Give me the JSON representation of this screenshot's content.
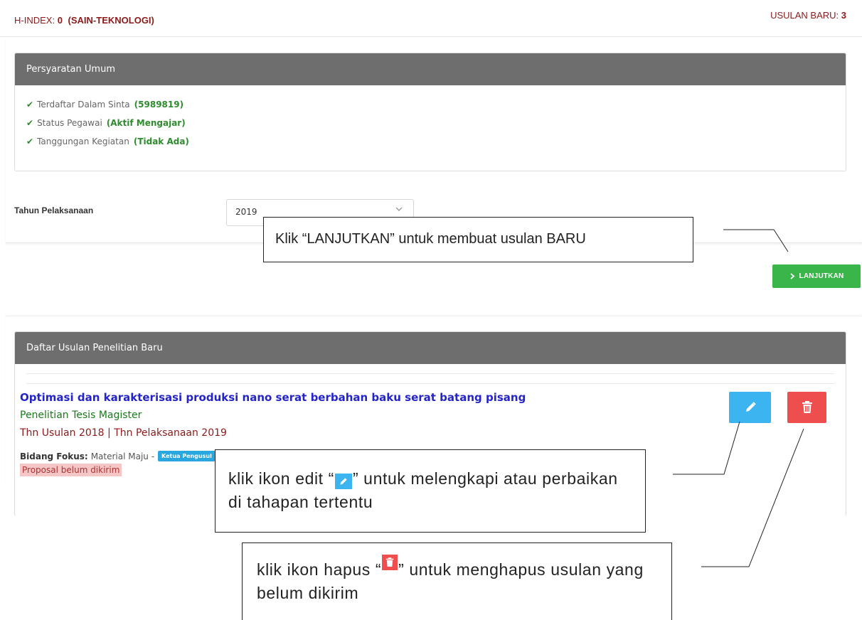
{
  "header": {
    "hindex_label": "H-INDEX:",
    "hindex_value": "0",
    "cluster": "(SAIN-TEKNOLOGI)",
    "usulan_label": "USULAN BARU:",
    "usulan_value": "3"
  },
  "requirements": {
    "title": "Persyaratan Umum",
    "items": [
      {
        "label": "Terdaftar Dalam Sinta",
        "value": "(5989819)"
      },
      {
        "label": "Status Pegawai",
        "value": "(Aktif Mengajar)"
      },
      {
        "label": "Tanggungan Kegiatan",
        "value": "(Tidak Ada)"
      }
    ]
  },
  "tahun": {
    "label": "Tahun Pelaksanaan",
    "selected": "2019"
  },
  "lanjutkan_button": "LANJUTKAN",
  "proposal_list": {
    "title": "Daftar Usulan Penelitian Baru",
    "items": [
      {
        "title": "Optimasi dan karakterisasi produksi nano serat berbahan baku serat batang pisang",
        "type": "Penelitian Tesis Magister",
        "years": "Thn Usulan 2018 | Thn Pelaksanaan 2019",
        "bidang_label": "Bidang Fokus:",
        "bidang_value": "Material Maju -",
        "role_badge": "Ketua Pengusul",
        "status": "Proposal belum dikirim"
      }
    ]
  },
  "annotations": {
    "lanjutkan": "Klik “LANJUTKAN” untuk membuat usulan BARU",
    "edit_pre": "klik ikon edit “",
    "edit_post": "” untuk melengkapi  atau perbaikan di tahapan tertentu",
    "hapus_pre": "klik ikon hapus “",
    "hapus_post": "” untuk menghapus usulan yang belum dikirim"
  },
  "colors": {
    "panel_header": "#6e6e6e",
    "success_green": "#39b54a",
    "edit_blue": "#3cb4ef",
    "delete_red": "#ef4e4e",
    "title_blue": "#2424c8",
    "maroon": "#8b1a1a"
  },
  "icons": [
    "check-icon",
    "chevron-down-icon",
    "chevron-right-icon",
    "pencil-icon",
    "trash-icon"
  ]
}
